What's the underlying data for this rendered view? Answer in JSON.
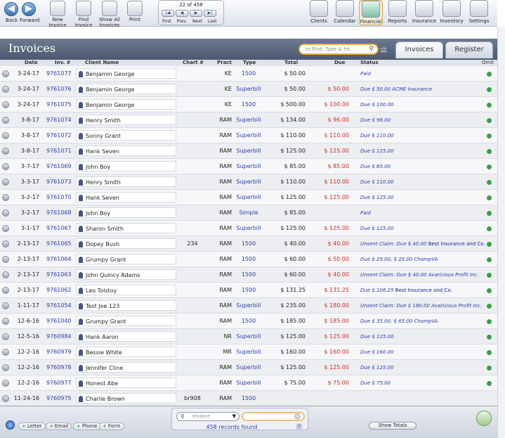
{
  "toolbar": {
    "back": "Back",
    "forward": "Forward",
    "new_invoice": "New Invoice",
    "find_invoice": "Find Invoice",
    "show_all": "Show All Invoices",
    "print": "Print"
  },
  "pager": {
    "count": "22 of 458",
    "first": "First",
    "prev": "Prev.",
    "next": "Next",
    "last": "Last"
  },
  "modules": [
    "Clients",
    "Calendar",
    "Financial",
    "Reports",
    "Insurance",
    "Inventory",
    "Settings"
  ],
  "active_module": "Financial",
  "page": {
    "title": "Invoices",
    "find_placeholder": "to Find: Type & hit",
    "clear": "clr",
    "tabs": [
      "Invoices",
      "Register"
    ]
  },
  "columns": {
    "date": "Date",
    "inv": "Inv. #",
    "client": "Client Name",
    "chart": "Chart #",
    "pract": "Pract",
    "type": "Type",
    "total": "Total",
    "due": "Due",
    "status": "Status",
    "omit": "Omit"
  },
  "rows": [
    {
      "date": "3-24-17",
      "inv": "9761077",
      "name": "Benjamin George",
      "chart": "",
      "pract": "KE",
      "type": "1500",
      "total": "$ 50.00",
      "due": "",
      "status": "Paid",
      "ins": ""
    },
    {
      "date": "3-24-17",
      "inv": "9761076",
      "name": "Benjamin George",
      "chart": "",
      "pract": "KE",
      "type": "Superbill",
      "total": "$ 50.00",
      "due": "$ 50.00",
      "status": "Due $ 50.00 ACME Insurance",
      "ins": ""
    },
    {
      "date": "3-24-17",
      "inv": "9761075",
      "name": "Benjamin George",
      "chart": "",
      "pract": "KE",
      "type": "1500",
      "total": "$ 500.00",
      "due": "$ 100.00",
      "status": "Due $ 100.00",
      "ins": ""
    },
    {
      "date": "3-8-17",
      "inv": "9761074",
      "name": "Henry Smith",
      "chart": "",
      "pract": "RAM",
      "type": "Superbill",
      "total": "$ 134.00",
      "due": "$ 96.00",
      "status": "Due $ 96.00",
      "ins": ""
    },
    {
      "date": "3-8-17",
      "inv": "9761072",
      "name": "Sonny Grant",
      "chart": "",
      "pract": "RAM",
      "type": "Superbill",
      "total": "$ 110.00",
      "due": "$ 110.00",
      "status": "Due $ 110.00",
      "ins": ""
    },
    {
      "date": "3-8-17",
      "inv": "9761071",
      "name": "Hank Seven",
      "chart": "",
      "pract": "RAM",
      "type": "Superbill",
      "total": "$ 125.00",
      "due": "$ 125.00",
      "status": "Due $ 125.00",
      "ins": ""
    },
    {
      "date": "3-7-17",
      "inv": "9761069",
      "name": "John Boy",
      "chart": "",
      "pract": "RAM",
      "type": "Superbill",
      "total": "$ 85.00",
      "due": "$ 85.00",
      "status": "Due $ 85.00",
      "ins": ""
    },
    {
      "date": "3-3-17",
      "inv": "9761073",
      "name": "Henry Smith",
      "chart": "",
      "pract": "RAM",
      "type": "Superbill",
      "total": "$ 110.00",
      "due": "$ 110.00",
      "status": "Due $ 110.00",
      "ins": ""
    },
    {
      "date": "3-2-17",
      "inv": "9761070",
      "name": "Hank Seven",
      "chart": "",
      "pract": "RAM",
      "type": "Superbill",
      "total": "$ 125.00",
      "due": "$ 125.00",
      "status": "Due $ 125.00",
      "ins": ""
    },
    {
      "date": "3-2-17",
      "inv": "9761068",
      "name": "John Boy",
      "chart": "",
      "pract": "RAM",
      "type": "Simple",
      "total": "$ 85.00",
      "due": "",
      "status": "Paid",
      "ins": ""
    },
    {
      "date": "3-1-17",
      "inv": "9761067",
      "name": "Sharon Smith",
      "chart": "",
      "pract": "RAM",
      "type": "Superbill",
      "total": "$ 125.00",
      "due": "$ 125.00",
      "status": "Due $ 125.00",
      "ins": ""
    },
    {
      "date": "2-13-17",
      "inv": "9761065",
      "name": "Dopey Bush",
      "chart": "234",
      "pract": "RAM",
      "type": "1500",
      "total": "$ 40.00",
      "due": "$ 40.00",
      "status": "Unsent Claim: Due $ 40.00",
      "ins": "Best Insurance and Co."
    },
    {
      "date": "2-13-17",
      "inv": "9761064",
      "name": "Grumpy Grant",
      "chart": "",
      "pract": "RAM",
      "type": "1500",
      "total": "$ 60.00",
      "due": "$ 50.00",
      "status": "Due $ 25.00, $ 25.00 ChampVA",
      "ins": ""
    },
    {
      "date": "2-13-17",
      "inv": "9761063",
      "name": "John Quincy Adams",
      "chart": "",
      "pract": "RAM",
      "type": "1500",
      "total": "$ 60.00",
      "due": "$ 40.00",
      "status": "Unsent Claim: Due $ 40.00 Avaricious Profit Inc.",
      "ins": ""
    },
    {
      "date": "2-13-17",
      "inv": "9761062",
      "name": "Leo Tolstoy",
      "chart": "",
      "pract": "RAM",
      "type": "1500",
      "total": "$ 131.25",
      "due": "$ 131.25",
      "status": "Due $ 106.25",
      "ins": "Best Insurance and Co."
    },
    {
      "date": "1-11-17",
      "inv": "9761054",
      "name": "Test Joe 123",
      "chart": "",
      "pract": "RAM",
      "type": "Superbill",
      "total": "$ 235.00",
      "due": "$ 180.00",
      "status": "Unsent Claim: Due $ 180.00 Avaricious Profit Inc.",
      "ins": ""
    },
    {
      "date": "12-6-16",
      "inv": "9761040",
      "name": "Grumpy Grant",
      "chart": "",
      "pract": "RAM",
      "type": "1500",
      "total": "$ 185.00",
      "due": "$ 185.00",
      "status": "Due $ 35.00, $ 65.00 ChampVA",
      "ins": ""
    },
    {
      "date": "12-5-16",
      "inv": "9760984",
      "name": "Hank Aaron",
      "chart": "",
      "pract": "NR",
      "type": "Superbill",
      "total": "$ 125.00",
      "due": "$ 125.00",
      "status": "Due $ 125.00",
      "ins": ""
    },
    {
      "date": "12-2-16",
      "inv": "9760979",
      "name": "Bessie White",
      "chart": "",
      "pract": "MR",
      "type": "Superbill",
      "total": "$ 160.00",
      "due": "$ 160.00",
      "status": "Due $ 160.00",
      "ins": ""
    },
    {
      "date": "12-2-16",
      "inv": "9760978",
      "name": "Jennifer Cline",
      "chart": "",
      "pract": "RAM",
      "type": "Superbill",
      "total": "$ 125.00",
      "due": "$ 125.00",
      "status": "Due $ 125.00",
      "ins": ""
    },
    {
      "date": "12-2-16",
      "inv": "9760977",
      "name": "Honest Abe",
      "chart": "",
      "pract": "RAM",
      "type": "Superbill",
      "total": "$ 75.00",
      "due": "$ 75.00",
      "status": "Due $ 75.00",
      "ins": ""
    },
    {
      "date": "11-24-16",
      "inv": "9760975",
      "name": "Charlie Brown",
      "chart": "br908",
      "pract": "RAM",
      "type": "1500",
      "total": "",
      "due": "",
      "status": "",
      "ins": ""
    }
  ],
  "bottom": {
    "actions": [
      "Letter",
      "Email",
      "Phone",
      "Form"
    ],
    "scope": "Invoice",
    "records_found": "458 records found",
    "help": "?",
    "show_totals": "Show Totals"
  },
  "colors": {
    "accent": "#e9a93c",
    "link": "#2a3fa8",
    "due": "#d32b20",
    "omit": "#3d9e45"
  }
}
